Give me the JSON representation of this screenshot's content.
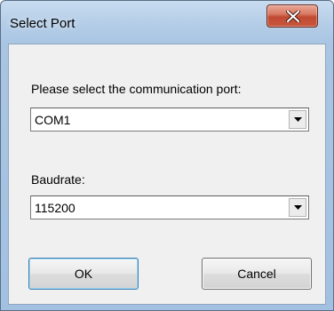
{
  "window": {
    "title": "Select Port",
    "close_icon": "close-x-icon"
  },
  "port": {
    "label": "Please select the communication port:",
    "selected": "COM1",
    "icon": "chevron-down-icon"
  },
  "baud": {
    "label": "Baudrate:",
    "selected": "115200",
    "icon": "chevron-down-icon"
  },
  "buttons": {
    "ok": "OK",
    "cancel": "Cancel"
  },
  "colors": {
    "frame": "#a9c5e3",
    "client": "#f0f0f0",
    "close_button": "#c8573c"
  }
}
